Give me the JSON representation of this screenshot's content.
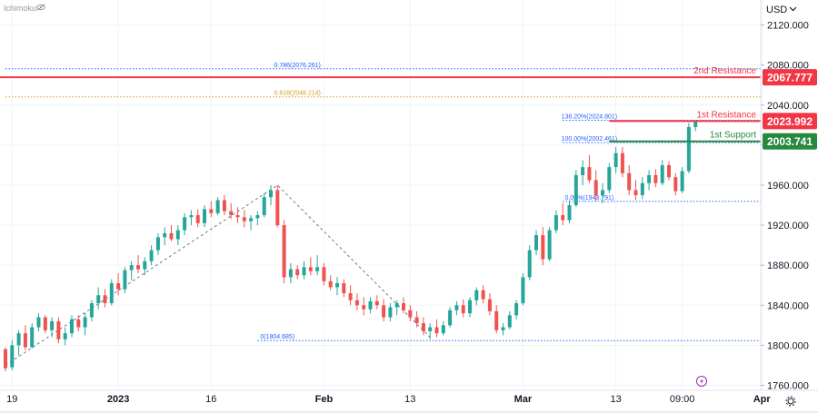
{
  "indicator_label": "Ichimoku",
  "eye_icon": "eye-slash-icon",
  "settings_icon": "gear-icon",
  "alert_icon": "lightning-bolt-icon",
  "currency": "USD",
  "chart_data": {
    "type": "candlestick",
    "ylim": [
      1755,
      2145
    ],
    "y_ticks": [
      1760,
      1800,
      1840,
      1880,
      1920,
      1960,
      2000,
      2040,
      2080,
      2120
    ],
    "y_tick_labels": [
      "1760.000",
      "1800.000",
      "1840.000",
      "1880.000",
      "1920.000",
      "1960.000",
      "2000.000",
      "2040.000",
      "2080.000",
      "2120.000"
    ],
    "x_ticks": [
      {
        "label": "19",
        "bar": 1
      },
      {
        "label": "2023",
        "bar": 17
      },
      {
        "label": "16",
        "bar": 31
      },
      {
        "label": "Feb",
        "bar": 48
      },
      {
        "label": "13",
        "bar": 61
      },
      {
        "label": "Mar",
        "bar": 78
      },
      {
        "label": "13",
        "bar": 92
      },
      {
        "label": "09:00",
        "bar": 102
      },
      {
        "label": "Apr",
        "bar": 114
      }
    ],
    "candles": [
      {
        "open": 1796,
        "high": 1798,
        "low": 1774,
        "close": 1777
      },
      {
        "open": 1778,
        "high": 1805,
        "low": 1775,
        "close": 1800
      },
      {
        "open": 1800,
        "high": 1815,
        "low": 1790,
        "close": 1812
      },
      {
        "open": 1812,
        "high": 1820,
        "low": 1795,
        "close": 1798
      },
      {
        "open": 1798,
        "high": 1822,
        "low": 1797,
        "close": 1818
      },
      {
        "open": 1818,
        "high": 1832,
        "low": 1814,
        "close": 1828
      },
      {
        "open": 1828,
        "high": 1830,
        "low": 1812,
        "close": 1815
      },
      {
        "open": 1815,
        "high": 1828,
        "low": 1808,
        "close": 1824
      },
      {
        "open": 1824,
        "high": 1828,
        "low": 1802,
        "close": 1806
      },
      {
        "open": 1806,
        "high": 1818,
        "low": 1800,
        "close": 1812
      },
      {
        "open": 1812,
        "high": 1830,
        "low": 1808,
        "close": 1826
      },
      {
        "open": 1826,
        "high": 1830,
        "low": 1814,
        "close": 1818
      },
      {
        "open": 1818,
        "high": 1832,
        "low": 1810,
        "close": 1828
      },
      {
        "open": 1828,
        "high": 1845,
        "low": 1824,
        "close": 1842
      },
      {
        "open": 1842,
        "high": 1858,
        "low": 1836,
        "close": 1850
      },
      {
        "open": 1850,
        "high": 1856,
        "low": 1838,
        "close": 1842
      },
      {
        "open": 1842,
        "high": 1866,
        "low": 1840,
        "close": 1862
      },
      {
        "open": 1862,
        "high": 1872,
        "low": 1850,
        "close": 1856
      },
      {
        "open": 1856,
        "high": 1878,
        "low": 1852,
        "close": 1875
      },
      {
        "open": 1875,
        "high": 1884,
        "low": 1865,
        "close": 1880
      },
      {
        "open": 1880,
        "high": 1890,
        "low": 1872,
        "close": 1876
      },
      {
        "open": 1876,
        "high": 1888,
        "low": 1870,
        "close": 1884
      },
      {
        "open": 1884,
        "high": 1900,
        "low": 1880,
        "close": 1895
      },
      {
        "open": 1895,
        "high": 1912,
        "low": 1890,
        "close": 1908
      },
      {
        "open": 1908,
        "high": 1918,
        "low": 1900,
        "close": 1912
      },
      {
        "open": 1912,
        "high": 1920,
        "low": 1904,
        "close": 1906
      },
      {
        "open": 1906,
        "high": 1920,
        "low": 1900,
        "close": 1915
      },
      {
        "open": 1915,
        "high": 1932,
        "low": 1910,
        "close": 1928
      },
      {
        "open": 1928,
        "high": 1935,
        "low": 1920,
        "close": 1930
      },
      {
        "open": 1930,
        "high": 1936,
        "low": 1918,
        "close": 1922
      },
      {
        "open": 1922,
        "high": 1940,
        "low": 1918,
        "close": 1936
      },
      {
        "open": 1936,
        "high": 1944,
        "low": 1928,
        "close": 1932
      },
      {
        "open": 1932,
        "high": 1948,
        "low": 1930,
        "close": 1945
      },
      {
        "open": 1945,
        "high": 1950,
        "low": 1930,
        "close": 1934
      },
      {
        "open": 1934,
        "high": 1942,
        "low": 1926,
        "close": 1930
      },
      {
        "open": 1930,
        "high": 1938,
        "low": 1922,
        "close": 1928
      },
      {
        "open": 1928,
        "high": 1935,
        "low": 1918,
        "close": 1924
      },
      {
        "open": 1924,
        "high": 1930,
        "low": 1915,
        "close": 1927
      },
      {
        "open": 1927,
        "high": 1934,
        "low": 1920,
        "close": 1930
      },
      {
        "open": 1930,
        "high": 1952,
        "low": 1928,
        "close": 1948
      },
      {
        "open": 1948,
        "high": 1960,
        "low": 1940,
        "close": 1955
      },
      {
        "open": 1955,
        "high": 1960,
        "low": 1918,
        "close": 1920
      },
      {
        "open": 1920,
        "high": 1925,
        "low": 1862,
        "close": 1868
      },
      {
        "open": 1868,
        "high": 1882,
        "low": 1862,
        "close": 1876
      },
      {
        "open": 1876,
        "high": 1880,
        "low": 1866,
        "close": 1870
      },
      {
        "open": 1870,
        "high": 1884,
        "low": 1866,
        "close": 1878
      },
      {
        "open": 1878,
        "high": 1888,
        "low": 1870,
        "close": 1874
      },
      {
        "open": 1874,
        "high": 1890,
        "low": 1870,
        "close": 1878
      },
      {
        "open": 1878,
        "high": 1882,
        "low": 1860,
        "close": 1864
      },
      {
        "open": 1864,
        "high": 1870,
        "low": 1855,
        "close": 1858
      },
      {
        "open": 1858,
        "high": 1868,
        "low": 1850,
        "close": 1862
      },
      {
        "open": 1862,
        "high": 1866,
        "low": 1848,
        "close": 1852
      },
      {
        "open": 1852,
        "high": 1860,
        "low": 1840,
        "close": 1845
      },
      {
        "open": 1845,
        "high": 1852,
        "low": 1835,
        "close": 1840
      },
      {
        "open": 1840,
        "high": 1848,
        "low": 1830,
        "close": 1836
      },
      {
        "open": 1836,
        "high": 1848,
        "low": 1832,
        "close": 1844
      },
      {
        "open": 1844,
        "high": 1850,
        "low": 1836,
        "close": 1840
      },
      {
        "open": 1840,
        "high": 1846,
        "low": 1824,
        "close": 1828
      },
      {
        "open": 1828,
        "high": 1842,
        "low": 1824,
        "close": 1838
      },
      {
        "open": 1838,
        "high": 1845,
        "low": 1830,
        "close": 1842
      },
      {
        "open": 1842,
        "high": 1848,
        "low": 1832,
        "close": 1835
      },
      {
        "open": 1835,
        "high": 1840,
        "low": 1824,
        "close": 1828
      },
      {
        "open": 1828,
        "high": 1834,
        "low": 1818,
        "close": 1822
      },
      {
        "open": 1822,
        "high": 1828,
        "low": 1810,
        "close": 1814
      },
      {
        "open": 1814,
        "high": 1822,
        "low": 1806,
        "close": 1818
      },
      {
        "open": 1818,
        "high": 1826,
        "low": 1808,
        "close": 1812
      },
      {
        "open": 1812,
        "high": 1824,
        "low": 1810,
        "close": 1820
      },
      {
        "open": 1820,
        "high": 1838,
        "low": 1818,
        "close": 1835
      },
      {
        "open": 1835,
        "high": 1844,
        "low": 1830,
        "close": 1840
      },
      {
        "open": 1840,
        "high": 1846,
        "low": 1828,
        "close": 1832
      },
      {
        "open": 1832,
        "high": 1848,
        "low": 1828,
        "close": 1845
      },
      {
        "open": 1845,
        "high": 1858,
        "low": 1840,
        "close": 1855
      },
      {
        "open": 1855,
        "high": 1860,
        "low": 1842,
        "close": 1846
      },
      {
        "open": 1846,
        "high": 1852,
        "low": 1830,
        "close": 1834
      },
      {
        "open": 1834,
        "high": 1840,
        "low": 1812,
        "close": 1815
      },
      {
        "open": 1815,
        "high": 1822,
        "low": 1810,
        "close": 1818
      },
      {
        "open": 1818,
        "high": 1834,
        "low": 1816,
        "close": 1830
      },
      {
        "open": 1830,
        "high": 1845,
        "low": 1826,
        "close": 1842
      },
      {
        "open": 1842,
        "high": 1872,
        "low": 1840,
        "close": 1868
      },
      {
        "open": 1868,
        "high": 1900,
        "low": 1865,
        "close": 1895
      },
      {
        "open": 1895,
        "high": 1915,
        "low": 1890,
        "close": 1910
      },
      {
        "open": 1910,
        "high": 1918,
        "low": 1880,
        "close": 1886
      },
      {
        "open": 1886,
        "high": 1918,
        "low": 1884,
        "close": 1915
      },
      {
        "open": 1915,
        "high": 1935,
        "low": 1912,
        "close": 1930
      },
      {
        "open": 1930,
        "high": 1942,
        "low": 1920,
        "close": 1925
      },
      {
        "open": 1925,
        "high": 1945,
        "low": 1922,
        "close": 1940
      },
      {
        "open": 1940,
        "high": 1975,
        "low": 1938,
        "close": 1970
      },
      {
        "open": 1970,
        "high": 1985,
        "low": 1960,
        "close": 1978
      },
      {
        "open": 1978,
        "high": 1990,
        "low": 1962,
        "close": 1965
      },
      {
        "open": 1965,
        "high": 1975,
        "low": 1944,
        "close": 1950
      },
      {
        "open": 1950,
        "high": 1962,
        "low": 1942,
        "close": 1955
      },
      {
        "open": 1955,
        "high": 1982,
        "low": 1952,
        "close": 1978
      },
      {
        "open": 1978,
        "high": 1998,
        "low": 1972,
        "close": 1992
      },
      {
        "open": 1992,
        "high": 1998,
        "low": 1968,
        "close": 1972
      },
      {
        "open": 1972,
        "high": 1980,
        "low": 1950,
        "close": 1955
      },
      {
        "open": 1955,
        "high": 1965,
        "low": 1945,
        "close": 1950
      },
      {
        "open": 1950,
        "high": 1968,
        "low": 1946,
        "close": 1962
      },
      {
        "open": 1962,
        "high": 1975,
        "low": 1955,
        "close": 1970
      },
      {
        "open": 1970,
        "high": 1976,
        "low": 1958,
        "close": 1962
      },
      {
        "open": 1962,
        "high": 1985,
        "low": 1960,
        "close": 1980
      },
      {
        "open": 1980,
        "high": 1984,
        "low": 1965,
        "close": 1968
      },
      {
        "open": 1968,
        "high": 1972,
        "low": 1950,
        "close": 1954
      },
      {
        "open": 1954,
        "high": 1978,
        "low": 1952,
        "close": 1974
      },
      {
        "open": 1974,
        "high": 2022,
        "low": 1972,
        "close": 2018
      },
      {
        "open": 2018,
        "high": 2025,
        "low": 2014,
        "close": 2023.992
      }
    ],
    "pivot_line": [
      {
        "bar": 0,
        "value": 1780
      },
      {
        "bar": 41,
        "value": 1960
      },
      {
        "bar": 64,
        "value": 1808
      }
    ],
    "fib_levels": [
      {
        "label": "0.786(2076.261)",
        "value": 2076.261,
        "color": "#2962ff",
        "bar_start": 0,
        "label_bar": 44
      },
      {
        "label": "0.618(2048.214)",
        "value": 2048.214,
        "color": "#d4a017",
        "bar_start": 0,
        "label_bar": 44
      },
      {
        "label": "0(1804.685)",
        "value": 1804.685,
        "color": "#2962ff",
        "bar_start": 38,
        "label_bar": 41
      },
      {
        "label": "138.20%(2024.801)",
        "value": 2024.801,
        "color": "#2962ff",
        "bar_start": 84,
        "label_bar": 88
      },
      {
        "label": "100.00%(2002.461)",
        "value": 2002.461,
        "color": "#2962ff",
        "bar_start": 84,
        "label_bar": 88
      },
      {
        "label": "0.00%(1943.791)",
        "value": 1943.791,
        "color": "#2962ff",
        "bar_start": 84,
        "label_bar": 88
      }
    ],
    "levels": [
      {
        "name": "2nd Resistance",
        "value": 2067.777,
        "label": "2067.777",
        "color": "#f23645"
      },
      {
        "name": "1st Resistance",
        "value": 2023.992,
        "label": "2023.992",
        "color": "#f23645"
      },
      {
        "name": "1st Support",
        "value": 2003.741,
        "label": "2003.741",
        "color": "#26893e"
      }
    ]
  }
}
